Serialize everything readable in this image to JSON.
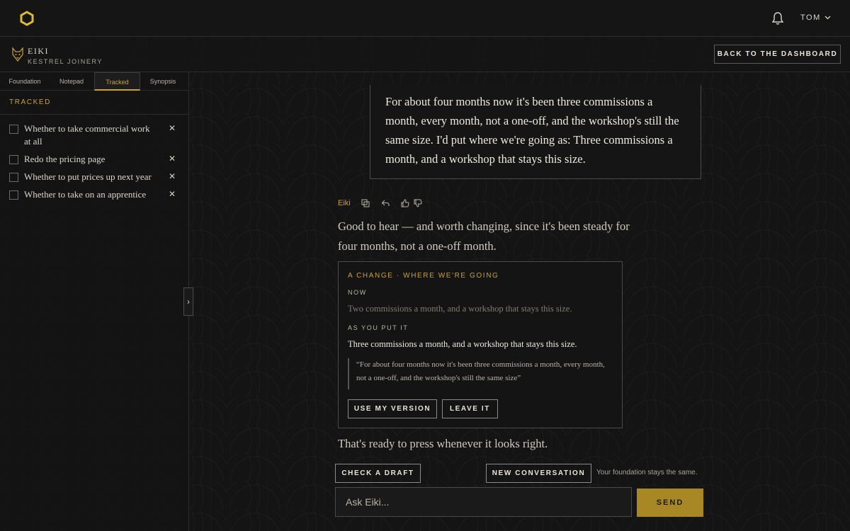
{
  "topbar": {
    "user_label": "TOM"
  },
  "brand": {
    "name": "EIKI",
    "subtitle": "KESTREL JOINERY"
  },
  "header": {
    "back_label": "BACK TO THE DASHBOARD"
  },
  "sidebar": {
    "tabs": [
      {
        "label": "Foundation"
      },
      {
        "label": "Notepad"
      },
      {
        "label": "Tracked"
      },
      {
        "label": "Synopsis"
      }
    ],
    "active_tab": "Tracked",
    "section_title": "TRACKED",
    "items": [
      {
        "label": "Whether to take commercial work at all"
      },
      {
        "label": "Redo the pricing page"
      },
      {
        "label": "Whether to put prices up next year"
      },
      {
        "label": "Whether to take on an apprentice"
      }
    ]
  },
  "conversation": {
    "user_quote": "For about four months now it's been three commissions a month, every month, not a one-off, and the workshop's still the same size. I'd put where we're going as: Three commissions a month, and a workshop that stays this size.",
    "assistant_name": "Eiki",
    "assistant_reply": "Good to hear — and worth changing, since it's been steady for four months, not a one-off month.",
    "change_card": {
      "kicker": "A CHANGE · WHERE WE'RE GOING",
      "now_label": "NOW",
      "now_value": "Two commissions a month, and a workshop that stays this size.",
      "as_you_put_label": "AS YOU PUT IT",
      "as_you_put_value": "Three commissions a month, and a workshop that stays this size.",
      "quote": "“For about four months now it's been three commissions a month, every month, not a one-off, and the workshop's still the same size”",
      "use_label": "USE MY VERSION",
      "leave_label": "LEAVE IT"
    },
    "closing": "That's ready to press whenever it looks right."
  },
  "actions": {
    "check_draft_label": "CHECK A DRAFT",
    "new_conversation_label": "NEW CONVERSATION",
    "note": "Your foundation stays the same."
  },
  "composer": {
    "placeholder": "Ask Eiki...",
    "send_label": "SEND"
  },
  "colors": {
    "accent": "#c9a13b",
    "send_bg": "#a88825",
    "background": "#141414"
  }
}
